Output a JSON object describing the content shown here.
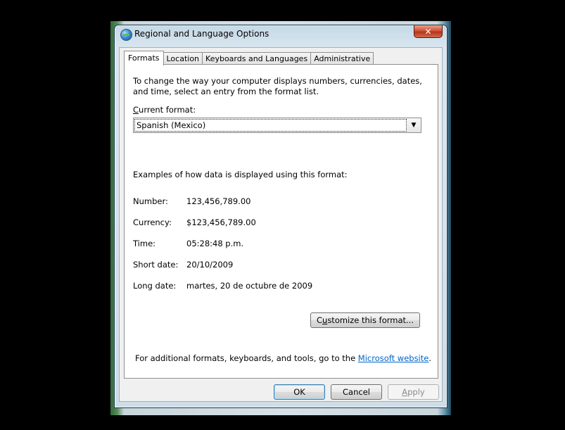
{
  "window": {
    "title": "Regional and Language Options",
    "close_glyph": "✕"
  },
  "tabs": [
    {
      "label": "Formats",
      "active": true
    },
    {
      "label": "Location",
      "active": false
    },
    {
      "label": "Keyboards and Languages",
      "active": false
    },
    {
      "label": "Administrative",
      "active": false
    }
  ],
  "formats": {
    "intro": "To change the way your computer displays numbers, currencies, dates, and time, select an entry from the format list.",
    "current_format_label_underlined": "C",
    "current_format_label_rest": "urrent format:",
    "current_format_value": "Spanish (Mexico)",
    "examples_title": "Examples of how data is displayed using this format:",
    "examples": [
      {
        "label": "Number:",
        "value": "123,456,789.00"
      },
      {
        "label": "Currency:",
        "value": "$123,456,789.00"
      },
      {
        "label": "Time:",
        "value": "05:28:48 p.m."
      },
      {
        "label": "Short date:",
        "value": "20/10/2009"
      },
      {
        "label": "Long date:",
        "value": "martes, 20 de octubre de 2009"
      }
    ],
    "customize_pre": "C",
    "customize_underlined": "u",
    "customize_post": "stomize this format...",
    "footer_text": "For additional formats, keyboards, and tools, go to the ",
    "footer_link": "Microsoft website",
    "footer_end": "."
  },
  "buttons": {
    "ok": "OK",
    "cancel": "Cancel",
    "apply_underlined": "A",
    "apply_rest": "pply"
  }
}
